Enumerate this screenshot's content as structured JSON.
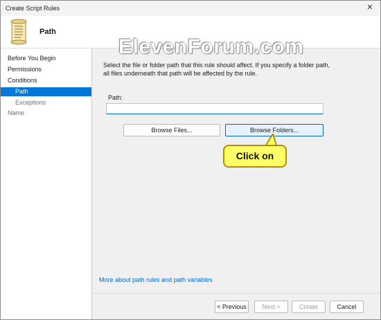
{
  "window": {
    "title": "Create Script Rules",
    "close_glyph": "✕"
  },
  "header": {
    "title": "Path",
    "icon": "script-scroll-icon"
  },
  "watermark": "ElevenForum.com",
  "sidebar": {
    "items": [
      {
        "label": "Before You Begin",
        "state": "normal",
        "sub": false
      },
      {
        "label": "Permissions",
        "state": "normal",
        "sub": false
      },
      {
        "label": "Conditions",
        "state": "normal",
        "sub": false
      },
      {
        "label": "Path",
        "state": "active",
        "sub": true
      },
      {
        "label": "Exceptions",
        "state": "disabled",
        "sub": true
      },
      {
        "label": "Name",
        "state": "disabled",
        "sub": false
      }
    ]
  },
  "content": {
    "description": "Select the file or folder path that this rule should affect. If you specify a folder path, all files underneath that path will be affected by the rule.",
    "path_label": "Path:",
    "path_value": "",
    "browse_files_label": "Browse Files...",
    "browse_folders_label": "Browse Folders...",
    "callout_text": "Click on",
    "more_link": "More about path rules and path variables"
  },
  "footer": {
    "previous_label": "< Previous",
    "next_label": "Next >",
    "create_label": "Create",
    "cancel_label": "Cancel"
  },
  "colors": {
    "accent": "#0078d7",
    "link": "#0066cc",
    "callout_fill": "#ffff66",
    "callout_border": "#b88a00"
  }
}
